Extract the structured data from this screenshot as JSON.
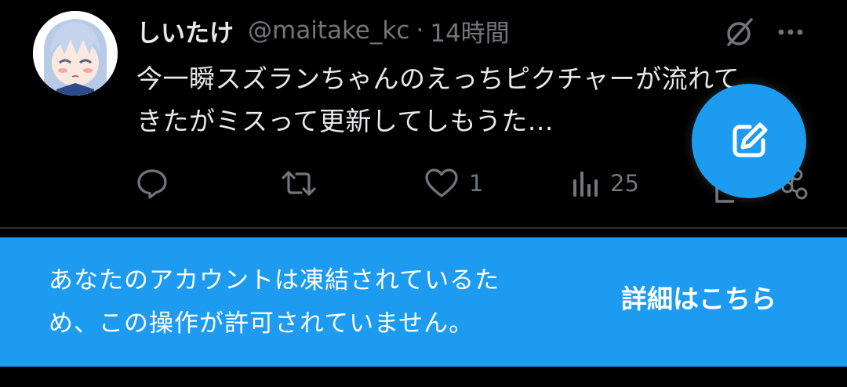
{
  "tweet": {
    "author": {
      "display_name": "しいたけ",
      "handle": "@maitake_kc"
    },
    "separator": "·",
    "time": "14時間",
    "text_lines": [
      "今一瞬スズランちゃんのえっちピクチャーが流れて",
      "きたがミスって更新してしもうた..."
    ],
    "actions": {
      "reply_count": "",
      "retweet_count": "",
      "like_count": "1",
      "view_count": "25"
    },
    "icons": {
      "grok": "grok-icon",
      "more": "more-icon",
      "reply": "reply-icon",
      "retweet": "retweet-icon",
      "like": "heart-icon",
      "views": "views-icon",
      "share": "share-icon",
      "compose": "compose-icon"
    }
  },
  "banner": {
    "message_lines": [
      "あなたのアカウントは凍結されているた",
      "め、この操作が許可されていません。"
    ],
    "link_label": "詳細はこちら"
  },
  "colors": {
    "background": "#000000",
    "accent": "#1d9bf0",
    "primary_text": "#e7e9ea",
    "secondary_text": "#71767b",
    "divider": "#2f3336"
  }
}
